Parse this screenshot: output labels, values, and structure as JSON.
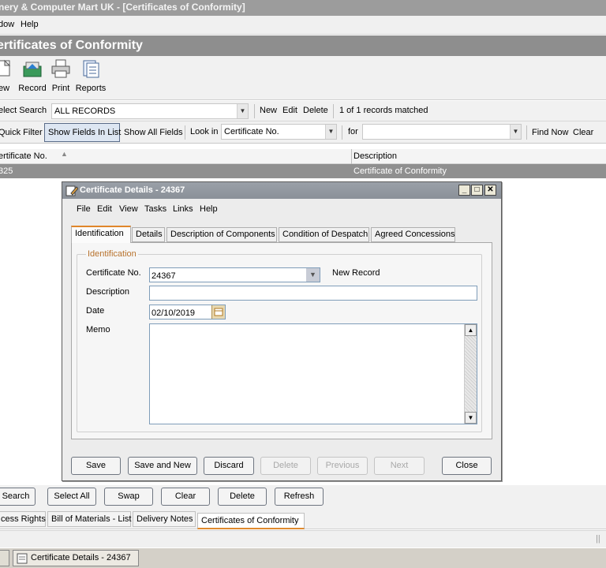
{
  "app": {
    "title": "nery & Computer Mart UK - [Certificates of Conformity]",
    "menu": [
      "dow",
      "Help"
    ],
    "header": "ertificates of Conformity"
  },
  "toolbar": {
    "items": [
      {
        "label": "ew",
        "icon": "new-icon"
      },
      {
        "label": "Record",
        "icon": "record-icon"
      },
      {
        "label": "Print",
        "icon": "print-icon"
      },
      {
        "label": "Reports",
        "icon": "reports-icon"
      }
    ]
  },
  "search": {
    "label": "elect Search",
    "value": "ALL RECORDS",
    "new": "New",
    "edit": "Edit",
    "delete": "Delete",
    "matched": "1 of 1 records matched"
  },
  "filter": {
    "quick_filter": "Quick Filter",
    "show_fields": "Show Fields In List",
    "show_all": "Show All Fields",
    "look_in_label": "Look in",
    "look_in_value": "Certificate No.",
    "for_label": "for",
    "for_value": "",
    "find_now": "Find Now",
    "clear": "Clear"
  },
  "list": {
    "columns": [
      "ertificate No.",
      "Description"
    ],
    "rows": [
      {
        "cert_no": "325",
        "description": "Certificate of Conformity"
      }
    ]
  },
  "dialog": {
    "title": "Certificate Details - 24367",
    "menu": [
      "File",
      "Edit",
      "View",
      "Tasks",
      "Links",
      "Help"
    ],
    "tabs": [
      "Identification",
      "Details",
      "Description of Components",
      "Condition of Despatch",
      "Agreed Concessions"
    ],
    "group_label": "Identification",
    "fields": {
      "cert_no_label": "Certificate No.",
      "cert_no_value": "24367",
      "new_record": "New Record",
      "description_label": "Description",
      "description_value": "",
      "date_label": "Date",
      "date_value": "02/10/2019",
      "memo_label": "Memo",
      "memo_value": ""
    },
    "buttons": {
      "save": "Save",
      "save_new": "Save and New",
      "discard": "Discard",
      "delete": "Delete",
      "previous": "Previous",
      "next": "Next",
      "close": "Close"
    }
  },
  "lower_buttons": [
    "Search",
    "Select All",
    "Swap",
    "Clear",
    "Delete",
    "Refresh"
  ],
  "bottom_tabs": [
    "cess Rights",
    "Bill of Materials - List",
    "Delivery Notes",
    "Certificates of Conformity"
  ],
  "taskbar": {
    "item": "Certificate Details - 24367"
  },
  "colors": {
    "accent": "#e08a2e",
    "header": "#8e8e8e",
    "selected_row": "#8f8f8f"
  }
}
